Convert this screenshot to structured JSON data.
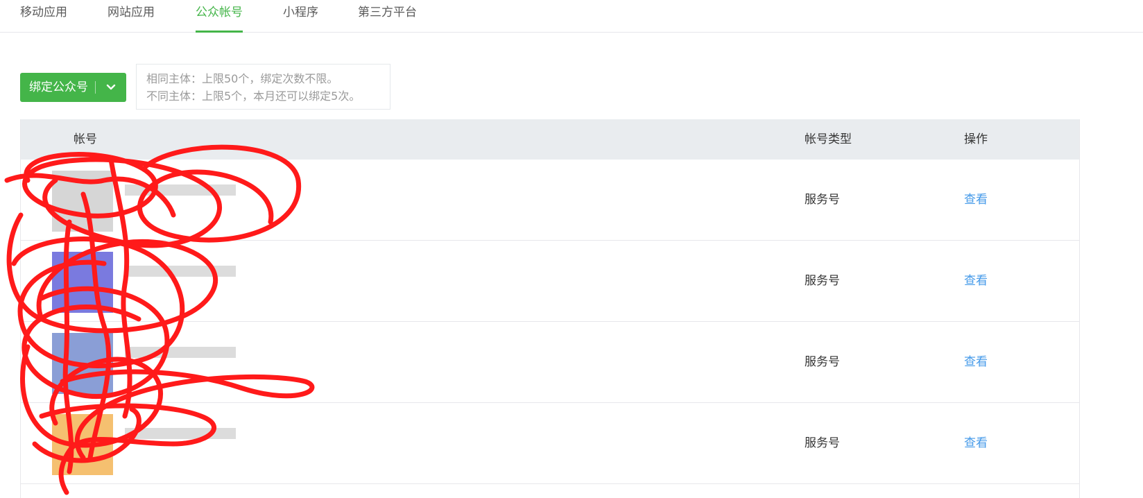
{
  "tabs": [
    {
      "label": "移动应用",
      "active": false
    },
    {
      "label": "网站应用",
      "active": false
    },
    {
      "label": "公众帐号",
      "active": true
    },
    {
      "label": "小程序",
      "active": false
    },
    {
      "label": "第三方平台",
      "active": false
    }
  ],
  "bind_button": {
    "label": "绑定公众号",
    "icon": "chevron-down-icon"
  },
  "hint": {
    "line1": "相同主体：上限50个，绑定次数不限。",
    "line2": "不同主体：上限5个，本月还可以绑定5次。"
  },
  "table": {
    "columns": [
      "帐号",
      "帐号类型",
      "操作"
    ],
    "rows": [
      {
        "type": "服务号",
        "action": "查看"
      },
      {
        "type": "服务号",
        "action": "查看"
      },
      {
        "type": "服务号",
        "action": "查看"
      },
      {
        "type": "服务号",
        "action": "查看"
      }
    ]
  },
  "colors": {
    "accent": "#44b549",
    "link": "#459ae9",
    "scribble": "#ff1a1a"
  }
}
